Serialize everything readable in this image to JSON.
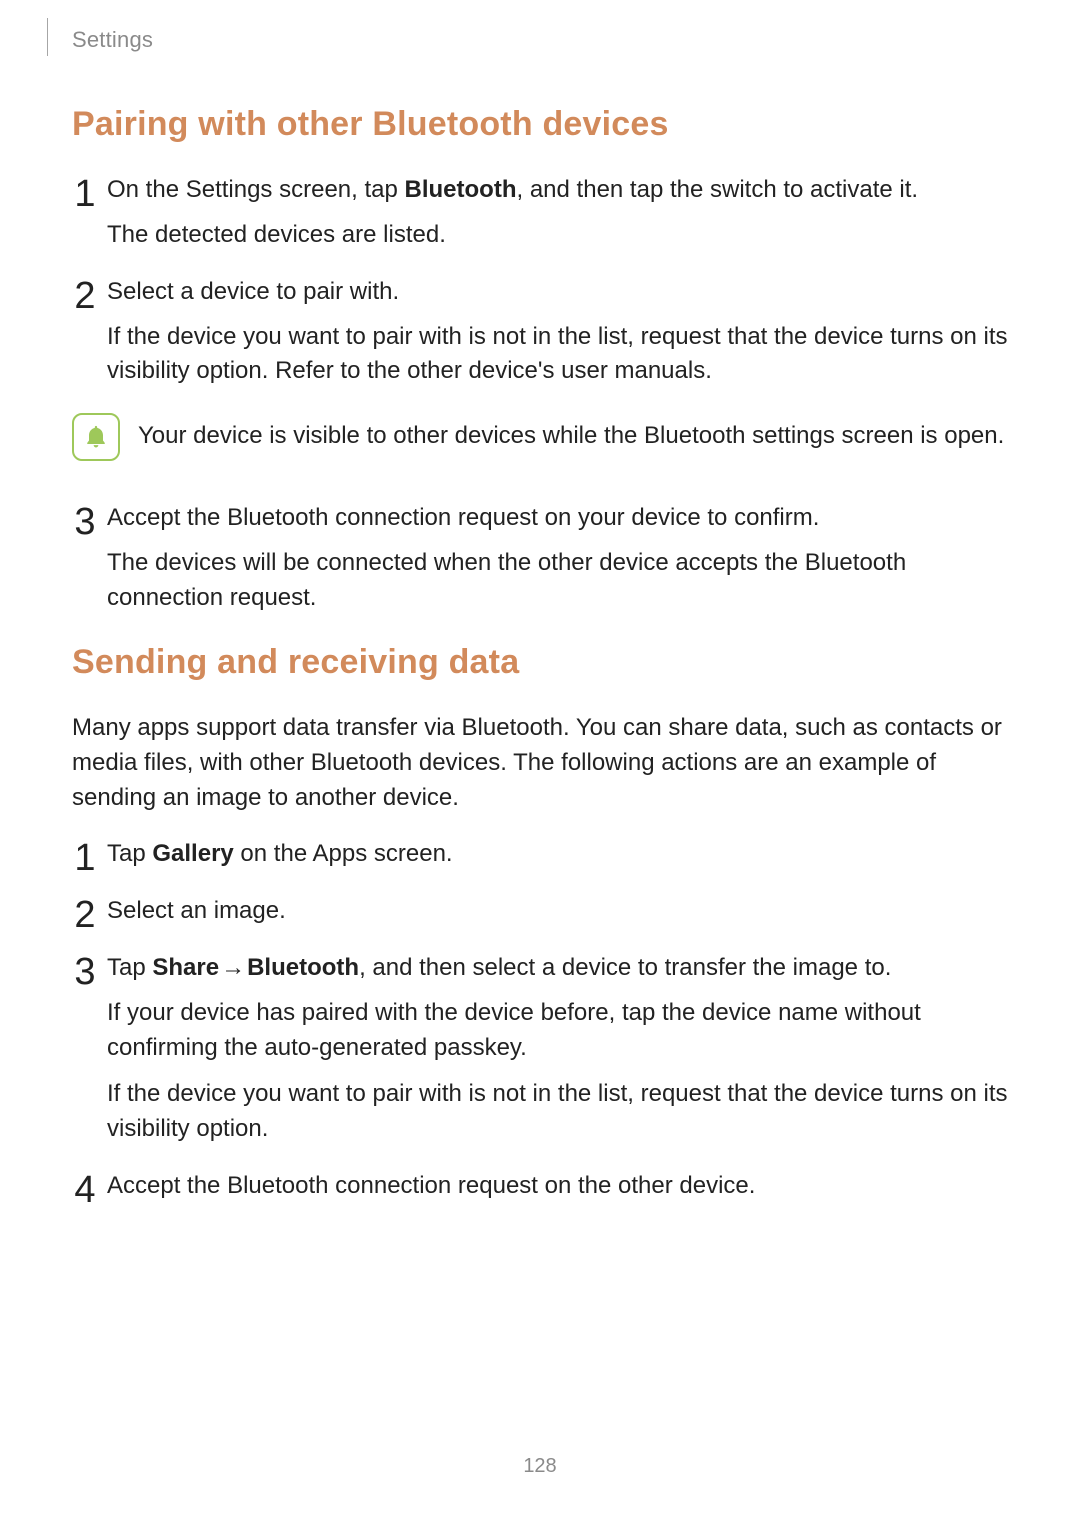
{
  "header": {
    "breadcrumb": "Settings"
  },
  "section1": {
    "title": "Pairing with other Bluetooth devices",
    "steps": {
      "s1": {
        "pre": "On the Settings screen, tap ",
        "bold": "Bluetooth",
        "post": ", and then tap the switch to activate it.",
        "sub1": "The detected devices are listed."
      },
      "s2": {
        "main": "Select a device to pair with.",
        "sub1": "If the device you want to pair with is not in the list, request that the device turns on its visibility option. Refer to the other device's user manuals."
      },
      "note": "Your device is visible to other devices while the Bluetooth settings screen is open.",
      "s3": {
        "main": "Accept the Bluetooth connection request on your device to confirm.",
        "sub1": "The devices will be connected when the other device accepts the Bluetooth connection request."
      }
    }
  },
  "section2": {
    "title": "Sending and receiving data",
    "intro": "Many apps support data transfer via Bluetooth. You can share data, such as contacts or media files, with other Bluetooth devices. The following actions are an example of sending an image to another device.",
    "steps": {
      "s1": {
        "pre": "Tap ",
        "bold": "Gallery",
        "post": " on the Apps screen."
      },
      "s2": {
        "main": "Select an image."
      },
      "s3": {
        "pre": "Tap ",
        "bold1": "Share",
        "arrow": " → ",
        "bold2": "Bluetooth",
        "post": ", and then select a device to transfer the image to.",
        "sub1": "If your device has paired with the device before, tap the device name without confirming the auto-generated passkey.",
        "sub2": "If the device you want to pair with is not in the list, request that the device turns on its visibility option."
      },
      "s4": {
        "main": "Accept the Bluetooth connection request on the other device."
      }
    }
  },
  "page_number": "128"
}
